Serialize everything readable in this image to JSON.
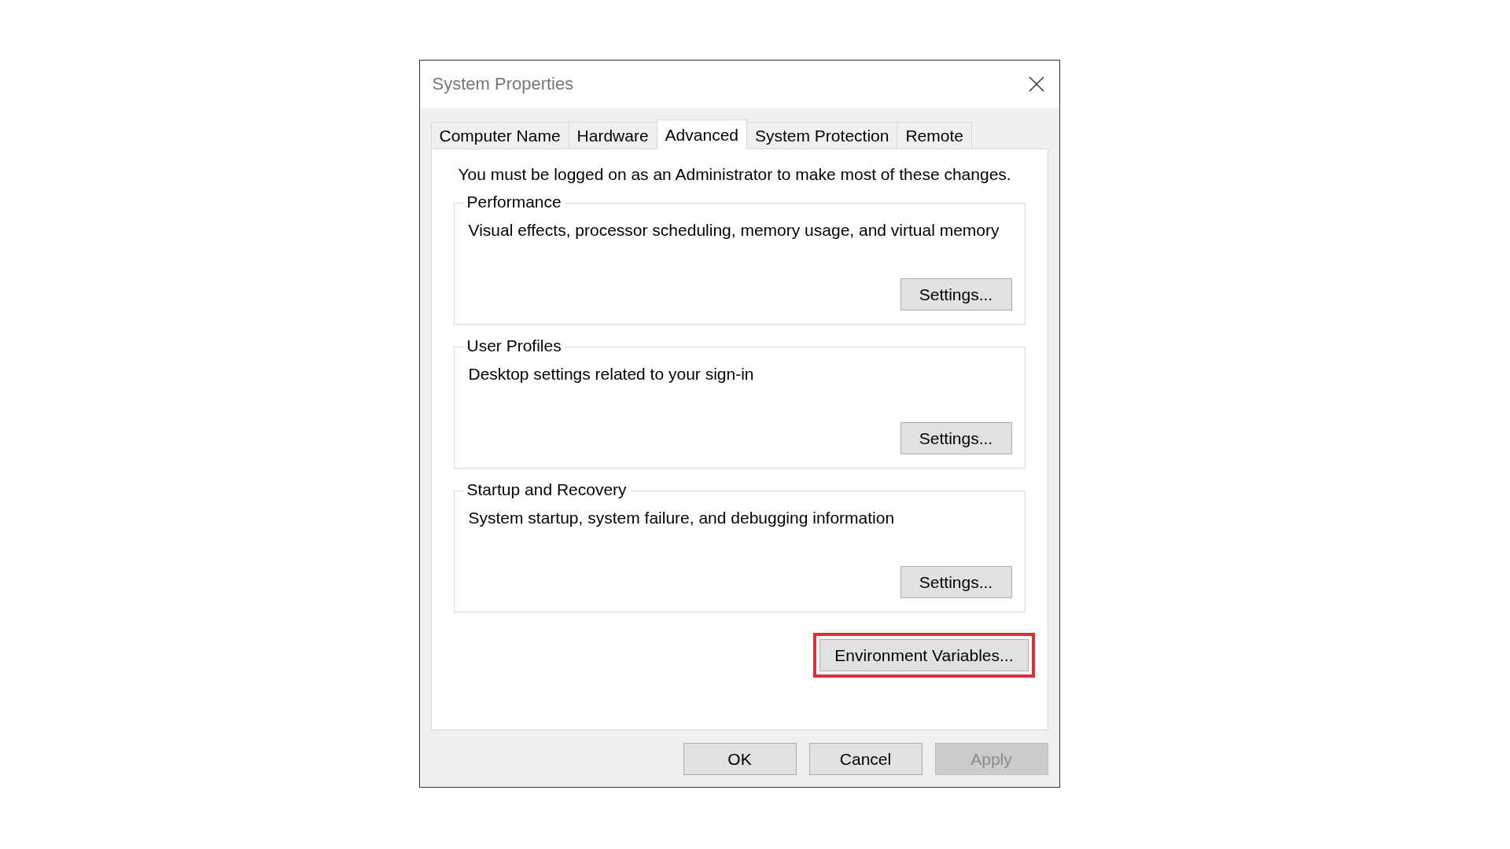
{
  "window": {
    "title": "System Properties"
  },
  "tabs": [
    {
      "label": "Computer Name",
      "selected": false
    },
    {
      "label": "Hardware",
      "selected": false
    },
    {
      "label": "Advanced",
      "selected": true
    },
    {
      "label": "System Protection",
      "selected": false
    },
    {
      "label": "Remote",
      "selected": false
    }
  ],
  "notice": "You must be logged on as an Administrator to make most of these changes.",
  "groups": [
    {
      "title": "Performance",
      "description": "Visual effects, processor scheduling, memory usage, and virtual memory",
      "button": "Settings..."
    },
    {
      "title": "User Profiles",
      "description": "Desktop settings related to your sign-in",
      "button": "Settings..."
    },
    {
      "title": "Startup and Recovery",
      "description": "System startup, system failure, and debugging information",
      "button": "Settings..."
    }
  ],
  "environment_button": {
    "label": "Environment Variables...",
    "highlighted": true
  },
  "buttons": [
    {
      "label": "OK",
      "disabled": false
    },
    {
      "label": "Cancel",
      "disabled": false
    },
    {
      "label": "Apply",
      "disabled": true
    }
  ]
}
